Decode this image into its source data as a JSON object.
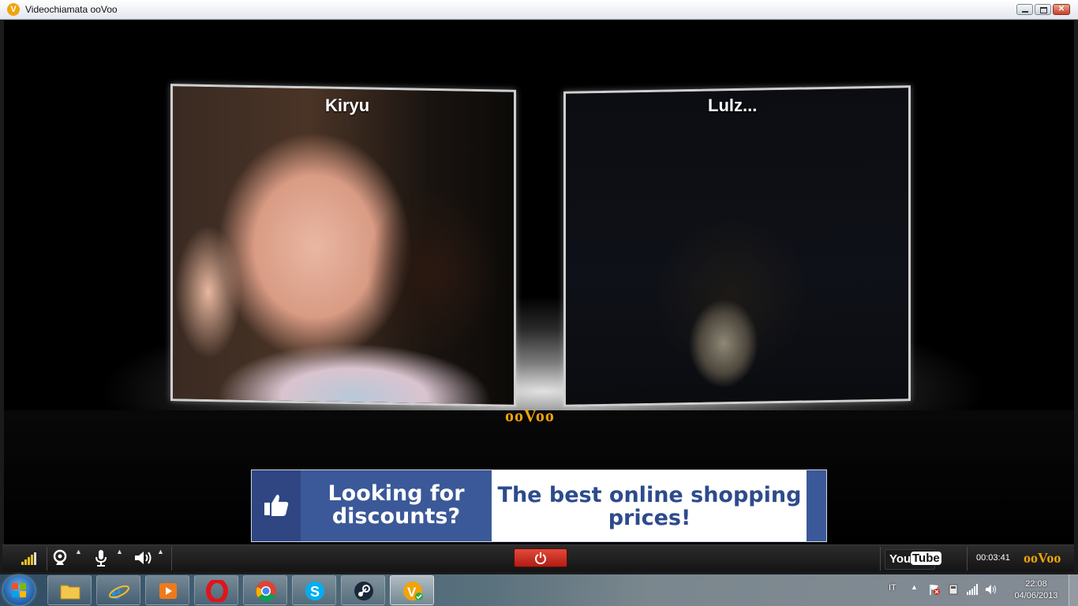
{
  "window": {
    "title": "Videochiamata ooVoo",
    "icon": "oovoo-app-icon",
    "controls": [
      "minimize",
      "maximize",
      "close"
    ]
  },
  "call": {
    "participants": [
      {
        "name": "Kiryu"
      },
      {
        "name": "Lulz..."
      }
    ],
    "brand_logo": "ooVoo",
    "timer": "00:03:41"
  },
  "ad": {
    "left_text": "Looking for discounts?",
    "right_text": "The best online shopping prices!",
    "icon": "thumbs-up-icon",
    "colors": {
      "brand_blue": "#3b5998",
      "text_blue": "#2d4b8c"
    }
  },
  "controls": {
    "signal_icon": "signal-strength-icon",
    "webcam_icon": "webcam-icon",
    "mic_icon": "microphone-icon",
    "speaker_icon": "speaker-icon",
    "end_call_icon": "power-icon",
    "youtube_you": "You",
    "youtube_tube": "Tube",
    "logo": "ooVoo",
    "colors": {
      "end_call": "#c9281c",
      "accent": "#f0a30a"
    }
  },
  "taskbar": {
    "start_icon": "windows-start-icon",
    "apps": [
      {
        "name": "file-explorer",
        "icon": "folder-icon",
        "active": false
      },
      {
        "name": "internet-explorer",
        "icon": "ie-icon",
        "active": false
      },
      {
        "name": "media-player",
        "icon": "media-player-icon",
        "active": false
      },
      {
        "name": "opera",
        "icon": "opera-icon",
        "active": false
      },
      {
        "name": "chrome",
        "icon": "chrome-icon",
        "active": false
      },
      {
        "name": "skype",
        "icon": "skype-icon",
        "active": false
      },
      {
        "name": "steam",
        "icon": "steam-icon",
        "active": false
      },
      {
        "name": "oovoo",
        "icon": "oovoo-icon",
        "active": true
      }
    ],
    "language": "IT",
    "time": "22:08",
    "date": "04/06/2013"
  }
}
